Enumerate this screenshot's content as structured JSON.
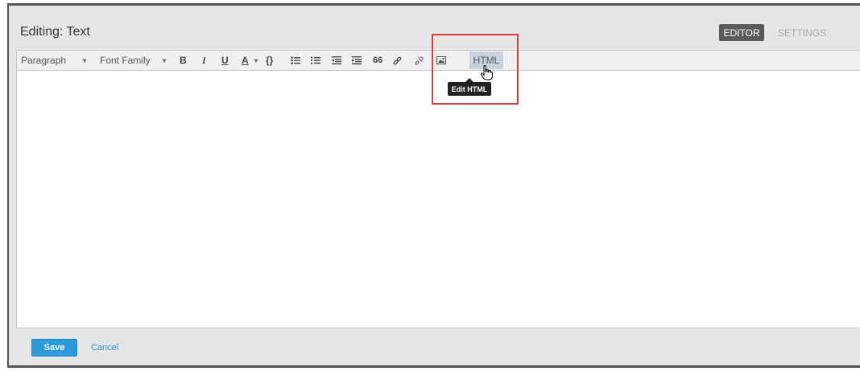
{
  "header": {
    "title": "Editing: Text",
    "tabs": [
      {
        "label": "EDITOR",
        "active": true
      },
      {
        "label": "SETTINGS",
        "active": false
      }
    ]
  },
  "toolbar": {
    "format_select": "Paragraph",
    "font_family_select": "Font Family",
    "bold_label": "B",
    "italic_label": "I",
    "underline_label": "U",
    "text_color_label": "A",
    "code_label": "{}",
    "blockquote_label": "66",
    "html_button_label": "HTML"
  },
  "tooltip": {
    "text": "Edit HTML"
  },
  "footer": {
    "save_label": "Save",
    "cancel_label": "Cancel"
  },
  "colors": {
    "highlight_border": "#e03b3b",
    "save_button": "#2c9bdb",
    "active_tab": "#5b5b5b",
    "link": "#2c8fd6"
  }
}
